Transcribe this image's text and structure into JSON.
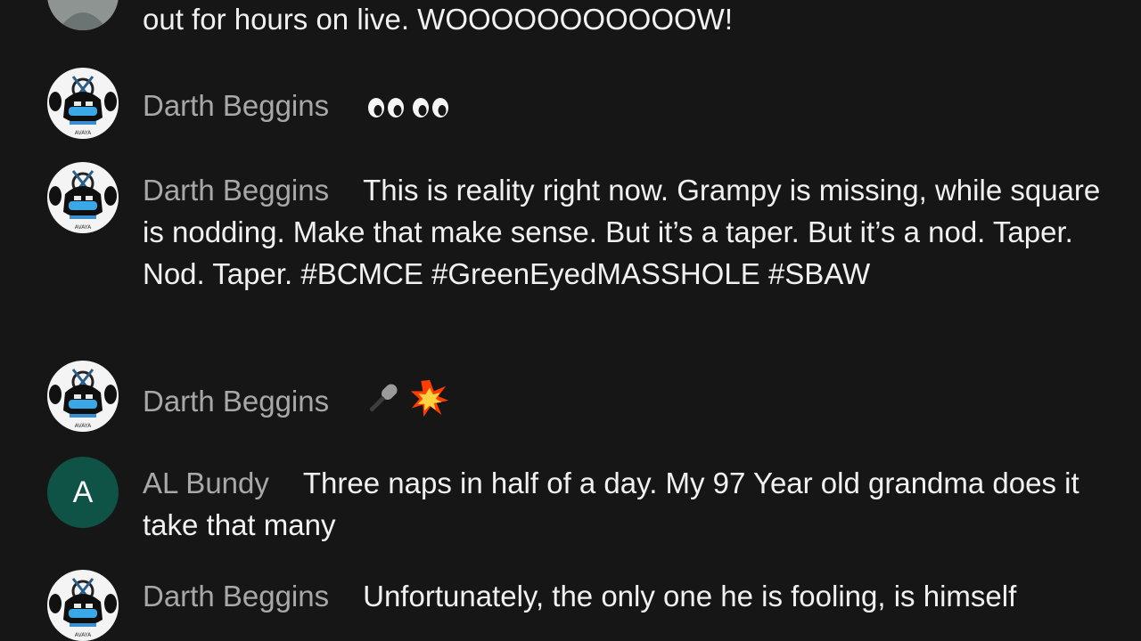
{
  "chat": {
    "messages": [
      {
        "author": "",
        "avatar": "photo",
        "text": "out for hours on live. WOOOOOOOOOOOW!"
      },
      {
        "author": "Darth Beggins",
        "avatar": "mask-icon",
        "emoji": [
          "eyes-icon",
          "eyes-icon"
        ]
      },
      {
        "author": "Darth Beggins",
        "avatar": "mask-icon",
        "text": "This is reality right now. Grampy is missing, while square is nodding. Make that make sense. But it’s a taper. But it’s a nod. Taper. Nod. Taper. #BCMCE #GreenEyedMASSHOLE #SBAW"
      },
      {
        "author": "Darth Beggins",
        "avatar": "mask-icon",
        "emoji": [
          "microphone-icon",
          "collision-icon"
        ]
      },
      {
        "author": "AL Bundy",
        "avatar_letter": "A",
        "avatar_color": "#0e5346",
        "text": "Three naps in half of a day. My 97 Year old grandma does it take that many"
      },
      {
        "author": "Darth Beggins",
        "avatar": "mask-icon",
        "text": "Unfortunately, the only one he is fooling, is himself"
      }
    ]
  },
  "colors": {
    "background": "#161616",
    "author": "#a8a8a8",
    "message": "#f1f1f1"
  }
}
